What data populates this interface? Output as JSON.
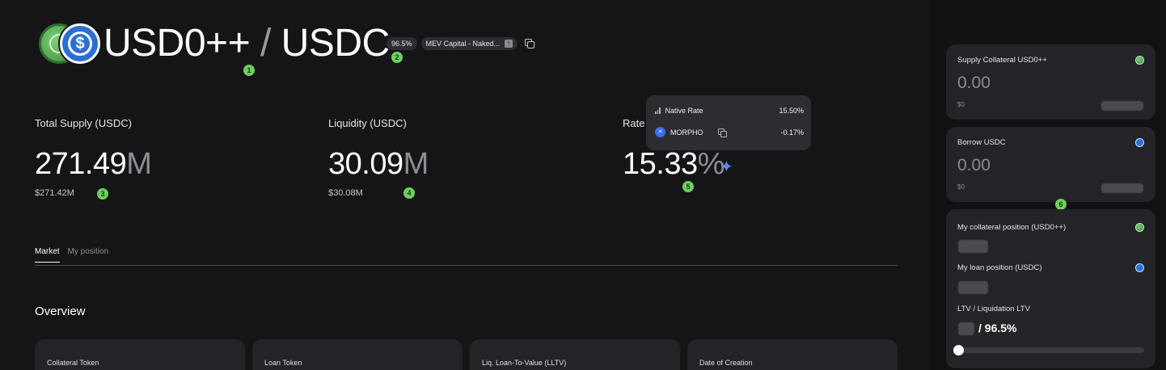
{
  "header": {
    "collateral_symbol": "USD0++",
    "separator": "/",
    "loan_symbol": "USDC",
    "lltv_badge": "96.5%",
    "vault_badge": "MEV Capital - Naked...",
    "vault_badge_icon": "!",
    "collateral_icon": "usd0-token-icon",
    "loan_icon": "usdc-token-icon"
  },
  "markers": [
    "1",
    "2",
    "3",
    "4",
    "5",
    "6"
  ],
  "stats": {
    "total_supply": {
      "label": "Total Supply (USDC)",
      "value": "271.49",
      "unit": "M",
      "usd": "$271.42M"
    },
    "liquidity": {
      "label": "Liquidity (USDC)",
      "value": "30.09",
      "unit": "M",
      "usd": "$30.08M"
    },
    "rate": {
      "label": "Rate",
      "value": "15.33",
      "unit": "%"
    }
  },
  "rate_tooltip": {
    "native_label": "Native Rate",
    "native_value": "15.50%",
    "reward_label": "MORPHO",
    "reward_value": "-0.17%"
  },
  "tabs": [
    {
      "label": "Market",
      "active": true
    },
    {
      "label": "My position",
      "active": false
    }
  ],
  "overview": {
    "title": "Overview",
    "cards": [
      "Collateral Token",
      "Loan Token",
      "Liq. Loan-To-Value (LLTV)",
      "Date of Creation"
    ]
  },
  "sidebar": {
    "supply": {
      "title": "Supply Collateral USD0++",
      "amount": "0.00",
      "usd": "$0"
    },
    "borrow": {
      "title": "Borrow USDC",
      "amount": "0.00",
      "usd": "$0"
    },
    "position": {
      "collateral_title": "My collateral position (USD0++)",
      "loan_title": "My loan position (USDC)",
      "ltv_title": "LTV / Liquidation LTV",
      "ltv_value": "/ 96.5%"
    }
  },
  "colors": {
    "background": "#151518",
    "card": "#242428",
    "marker": "#6fcf5e",
    "accent_blue": "#5b8cff"
  }
}
